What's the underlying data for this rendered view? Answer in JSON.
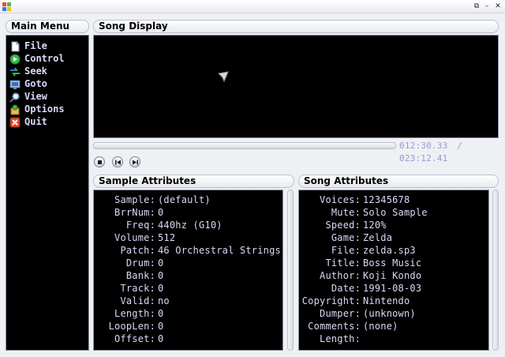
{
  "window": {
    "app_icon": "windows-flag-icon",
    "restore_glyph": "⧉",
    "minimize_glyph": "–",
    "close_glyph": "✕"
  },
  "main_menu": {
    "title": "Main Menu",
    "items": [
      {
        "label": "File",
        "icon": "file-icon"
      },
      {
        "label": "Control",
        "icon": "control-icon"
      },
      {
        "label": "Seek",
        "icon": "seek-icon"
      },
      {
        "label": "Goto",
        "icon": "goto-icon"
      },
      {
        "label": "View",
        "icon": "view-icon"
      },
      {
        "label": "Options",
        "icon": "options-icon"
      },
      {
        "label": "Quit",
        "icon": "quit-icon"
      }
    ]
  },
  "song_display": {
    "title": "Song Display",
    "time_current": "012:30.33",
    "time_separator": "/",
    "time_total": "023:12.41",
    "controls": [
      "stop-button",
      "previous-button",
      "next-button"
    ]
  },
  "sample_attributes": {
    "title": "Sample Attributes",
    "rows": [
      {
        "key": "Sample:",
        "value": "(default)"
      },
      {
        "key": "BrrNum:",
        "value": "0"
      },
      {
        "key": "Freq:",
        "value": "440hz (G10)"
      },
      {
        "key": "Volume:",
        "value": "512"
      },
      {
        "key": "Patch:",
        "value": "46 Orchestral Strings"
      },
      {
        "key": "Drum:",
        "value": "0"
      },
      {
        "key": "Bank:",
        "value": "0"
      },
      {
        "key": "Track:",
        "value": "0"
      },
      {
        "key": "Valid:",
        "value": "no"
      },
      {
        "key": "Length:",
        "value": "0"
      },
      {
        "key": "LoopLen:",
        "value": "0"
      },
      {
        "key": "Offset:",
        "value": "0"
      }
    ]
  },
  "song_attributes": {
    "title": "Song Attributes",
    "rows": [
      {
        "key": "Voices:",
        "value": "12345678"
      },
      {
        "key": "Mute:",
        "value": "Solo Sample"
      },
      {
        "key": "Speed:",
        "value": "120%"
      },
      {
        "key": "Game:",
        "value": "Zelda"
      },
      {
        "key": "File:",
        "value": "zelda.sp3"
      },
      {
        "key": "Title:",
        "value": "Boss Music"
      },
      {
        "key": "Author:",
        "value": "Koji Kondo"
      },
      {
        "key": "Date:",
        "value": "1991-08-03"
      },
      {
        "key": "Copyright:",
        "value": "Nintendo"
      },
      {
        "key": "Dumper:",
        "value": "(unknown)"
      },
      {
        "key": "Comments:",
        "value": "(none)"
      },
      {
        "key": "Length:",
        "value": ""
      }
    ]
  }
}
